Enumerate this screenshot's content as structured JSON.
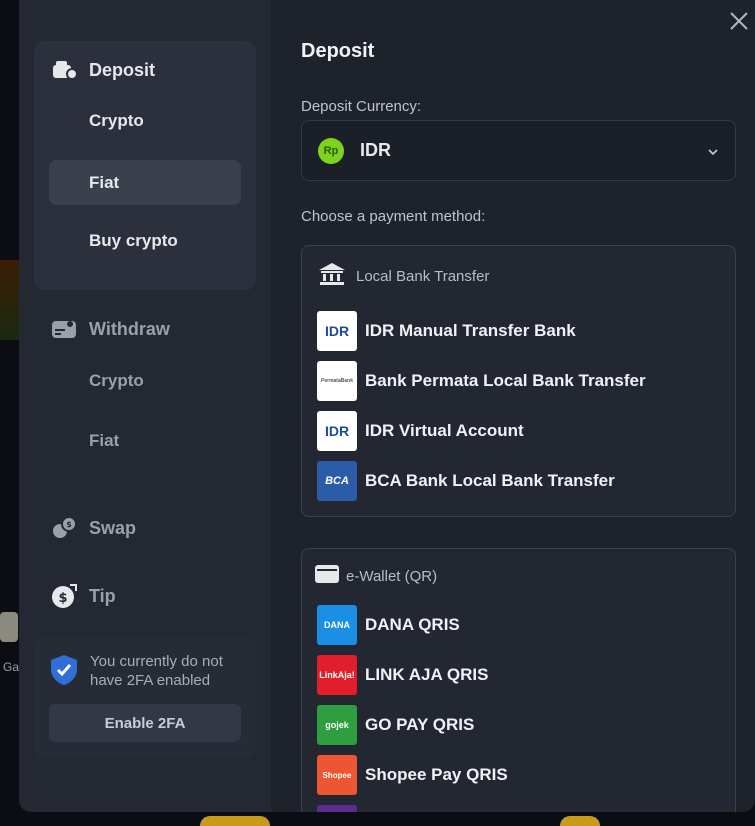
{
  "backdrop": {
    "game_label": "Ga"
  },
  "sidebar": {
    "deposit": {
      "label": "Deposit",
      "items": [
        "Crypto",
        "Fiat",
        "Buy crypto"
      ]
    },
    "withdraw": {
      "label": "Withdraw",
      "items": [
        "Crypto",
        "Fiat"
      ]
    },
    "swap_label": "Swap",
    "tip_label": "Tip",
    "twofa": {
      "message": "You currently do not have 2FA enabled",
      "button": "Enable 2FA"
    }
  },
  "main": {
    "title": "Deposit",
    "currency_label": "Deposit Currency:",
    "currency": {
      "code": "IDR",
      "icon_text": "Rp"
    },
    "method_label": "Choose a payment method:",
    "groups": [
      {
        "title": "Local Bank Transfer",
        "methods": [
          {
            "name": "IDR Manual Transfer Bank",
            "logo_text": "IDR"
          },
          {
            "name": "Bank Permata Local Bank Transfer",
            "logo_text": "PermataBank"
          },
          {
            "name": "IDR Virtual Account",
            "logo_text": "IDR"
          },
          {
            "name": "BCA Bank Local Bank Transfer",
            "logo_text": "BCA"
          }
        ]
      },
      {
        "title": "e-Wallet (QR)",
        "methods": [
          {
            "name": "DANA QRIS",
            "logo_text": "DANA"
          },
          {
            "name": "LINK AJA QRIS",
            "logo_text": "LinkAja!"
          },
          {
            "name": "GO PAY QRIS",
            "logo_text": "gojek"
          },
          {
            "name": "Shopee Pay QRIS",
            "logo_text": "Shopee"
          }
        ]
      }
    ]
  },
  "colors": {
    "accent_green": "#7ed321",
    "modal_bg": "#1e222b",
    "sidebar_bg": "#242833",
    "twofa_shield": "#2f6fd6"
  }
}
